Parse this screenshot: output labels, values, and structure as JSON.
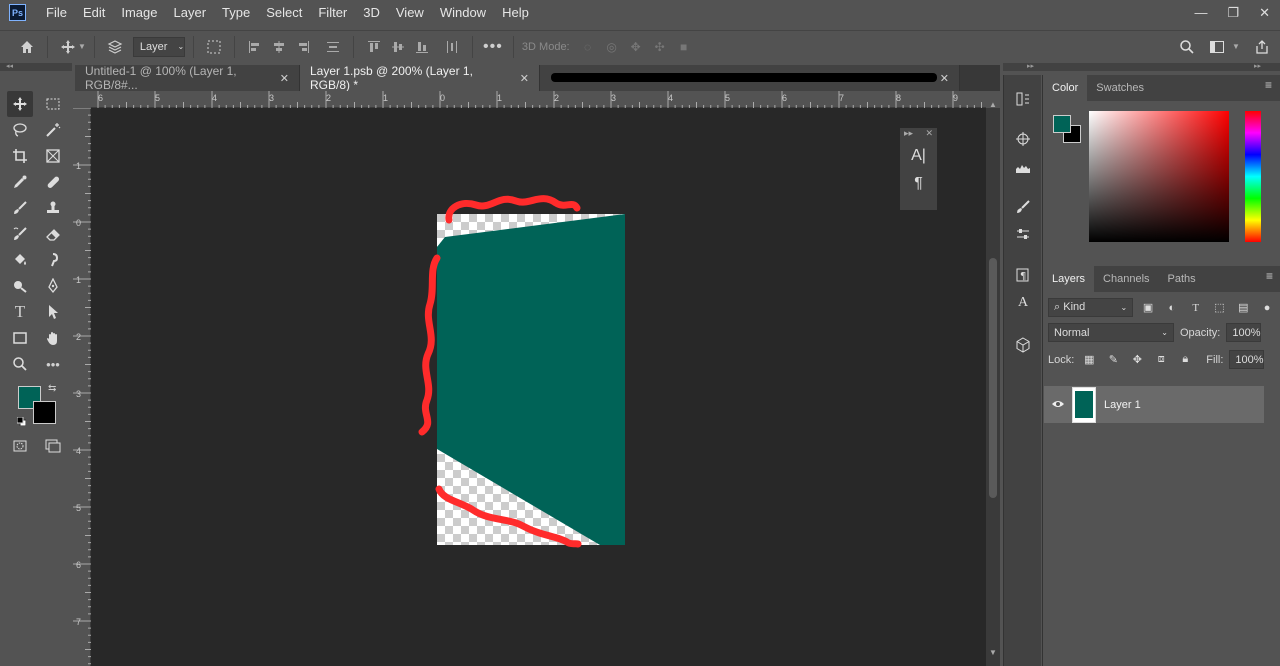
{
  "app": {
    "logo": "Ps"
  },
  "menu": [
    "File",
    "Edit",
    "Image",
    "Layer",
    "Type",
    "Select",
    "Filter",
    "3D",
    "View",
    "Window",
    "Help"
  ],
  "window_controls": {
    "minimize": "—",
    "restore": "❐",
    "close": "✕"
  },
  "options_bar": {
    "auto_select_value": "Layer",
    "mode_3d_label": "3D Mode:"
  },
  "tabs": [
    {
      "label": "Untitled-1 @ 100% (Layer 1, RGB/8#...",
      "close": "✕",
      "active": false
    },
    {
      "label": "Layer 1.psb @ 200% (Layer 1, RGB/8) *",
      "close": "✕",
      "active": true
    },
    {
      "label": "",
      "close": "✕",
      "active": false
    }
  ],
  "rulers": {
    "top": [
      "6",
      "5",
      "4",
      "3",
      "2",
      "1",
      "0",
      "1",
      "2",
      "3",
      "4",
      "5",
      "6",
      "7",
      "8",
      "9"
    ],
    "left": [
      "1",
      "0",
      "1",
      "2",
      "3",
      "4",
      "5",
      "6",
      "7"
    ]
  },
  "float_panel": {
    "char_icon": "A|",
    "para_icon": "¶"
  },
  "colors": {
    "foreground": "#006357",
    "background": "#000000",
    "canvas": "#282828",
    "annotation": "#ff2b2b"
  },
  "color_panel": {
    "tabs": [
      "Color",
      "Swatches"
    ]
  },
  "layers_panel": {
    "tabs": [
      "Layers",
      "Channels",
      "Paths"
    ],
    "filter_kind": "Kind",
    "blend_mode": "Normal",
    "opacity_label": "Opacity:",
    "opacity_value": "100%",
    "lock_label": "Lock:",
    "fill_label": "Fill:",
    "fill_value": "100%",
    "layers": [
      {
        "name": "Layer 1",
        "visible": true
      }
    ]
  }
}
